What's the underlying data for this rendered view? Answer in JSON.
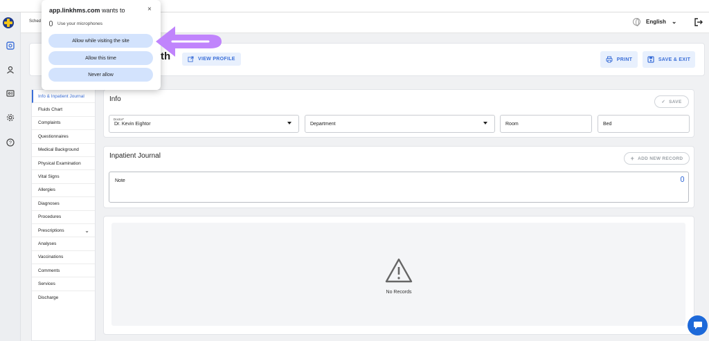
{
  "header": {
    "schedule_fragment": "Sched",
    "language": "English"
  },
  "patient": {
    "name_fragment": "th",
    "view_profile": "VIEW PROFILE",
    "print": "PRINT",
    "save_exit": "SAVE & EXIT"
  },
  "side_menu": {
    "items": [
      {
        "label": "Info & Inpatient Journal"
      },
      {
        "label": "Fluids Chart"
      },
      {
        "label": "Complaints"
      },
      {
        "label": "Questionnaires"
      },
      {
        "label": "Medical Background"
      },
      {
        "label": "Physical Examination"
      },
      {
        "label": "Vital Signs"
      },
      {
        "label": "Allergies"
      },
      {
        "label": "Diagnoses"
      },
      {
        "label": "Procedures"
      },
      {
        "label": "Prescriptions"
      },
      {
        "label": "Analyses"
      },
      {
        "label": "Vaccinations"
      },
      {
        "label": "Comments"
      },
      {
        "label": "Services"
      },
      {
        "label": "Discharge"
      }
    ]
  },
  "info": {
    "title": "Info",
    "save": "SAVE",
    "doctor_label": "Doctor*",
    "doctor_value": "Dr. Kevin Eightor",
    "department": "Department",
    "room": "Room",
    "bed": "Bed"
  },
  "journal": {
    "title": "Inpatient Journal",
    "add_record": "ADD NEW RECORD",
    "note": "Note"
  },
  "records": {
    "empty": "No Records"
  },
  "permission_popup": {
    "origin": "app.linkhms.com",
    "wants_to": "wants to",
    "permission": "Use your microphones",
    "close": "×",
    "allow_site": "Allow while visiting the site",
    "allow_once": "Allow this time",
    "never": "Never allow"
  },
  "colors": {
    "accent": "#3b6fd8",
    "popup_button": "#d3e3fd",
    "annotation_arrow": "#c084fc",
    "chat": "#1d69d9"
  }
}
